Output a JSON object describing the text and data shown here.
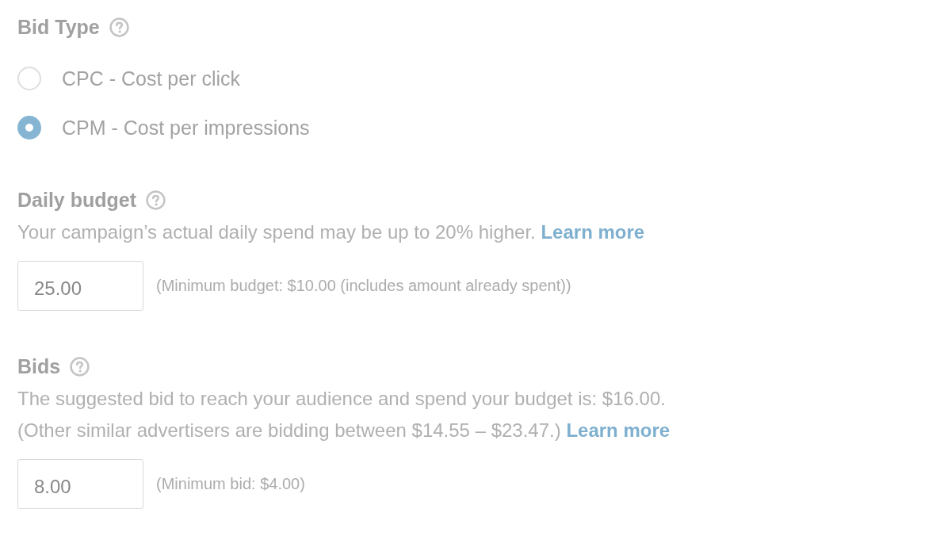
{
  "sections": [
    {
      "kind": "radio_group",
      "title": "Bid Type",
      "options": [
        {
          "label": "CPC - Cost per click",
          "selected": false
        },
        {
          "label": "CPM - Cost per impressions",
          "selected": true
        }
      ]
    },
    {
      "kind": "amount",
      "title": "Daily budget",
      "description": {
        "lines": [
          "Your campaign’s actual daily spend may be up to 20% higher."
        ],
        "link": "Learn more"
      },
      "value": "25.00",
      "hint": "(Minimum budget: $10.00 (includes amount already spent))"
    },
    {
      "kind": "amount",
      "title": "Bids",
      "description": {
        "lines": [
          "The suggested bid to reach your audience and spend your budget is: $16.00.",
          "(Other similar advertisers are bidding between $14.55 – $23.47.)"
        ],
        "link": "Learn more"
      },
      "value": "8.00",
      "hint": "(Minimum bid: $4.00)"
    }
  ]
}
